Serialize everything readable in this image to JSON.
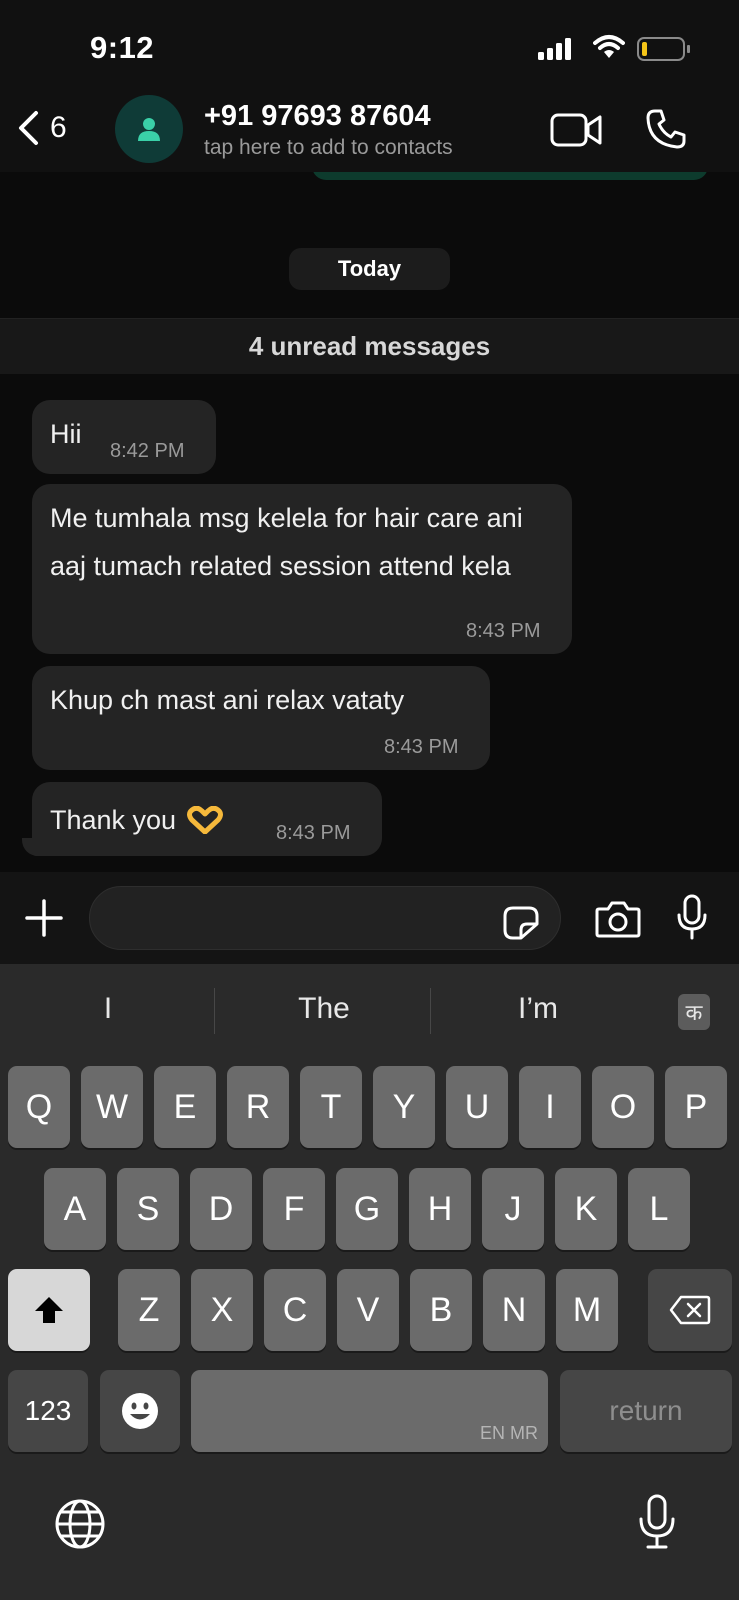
{
  "status_bar": {
    "time": "9:12",
    "battery_color": "#f5c518"
  },
  "header": {
    "back_count": "6",
    "contact_name": "+91 97693 87604",
    "contact_subtitle": "tap here to add to contacts",
    "icons": [
      "chevron-left-icon",
      "person-icon",
      "video-call-icon",
      "phone-icon"
    ]
  },
  "chat": {
    "date_label": "Today",
    "unread_label": "4 unread messages",
    "messages": [
      {
        "text": "Hii",
        "time": "8:42 PM"
      },
      {
        "text": "Me tumhala msg kelela for hair care ani aaj tumach related session attend kela",
        "time": "8:43 PM"
      },
      {
        "text": "Khup ch mast ani relax vataty",
        "time": "8:43 PM"
      },
      {
        "text": "Thank you",
        "emoji": "heart-hands-icon",
        "time": "8:43 PM"
      }
    ]
  },
  "input_bar": {
    "message_value": "",
    "icons": [
      "plus-icon",
      "sticker-icon",
      "camera-icon",
      "microphone-icon"
    ]
  },
  "keyboard": {
    "suggestions": [
      "I",
      "The",
      "I’m"
    ],
    "language_key": "क",
    "row1": [
      "Q",
      "W",
      "E",
      "R",
      "T",
      "Y",
      "U",
      "I",
      "O",
      "P"
    ],
    "row2": [
      "A",
      "S",
      "D",
      "F",
      "G",
      "H",
      "J",
      "K",
      "L"
    ],
    "row3": [
      "Z",
      "X",
      "C",
      "V",
      "B",
      "N",
      "M"
    ],
    "numbers_label": "123",
    "space_lang_label": "EN MR",
    "return_label": "return"
  }
}
